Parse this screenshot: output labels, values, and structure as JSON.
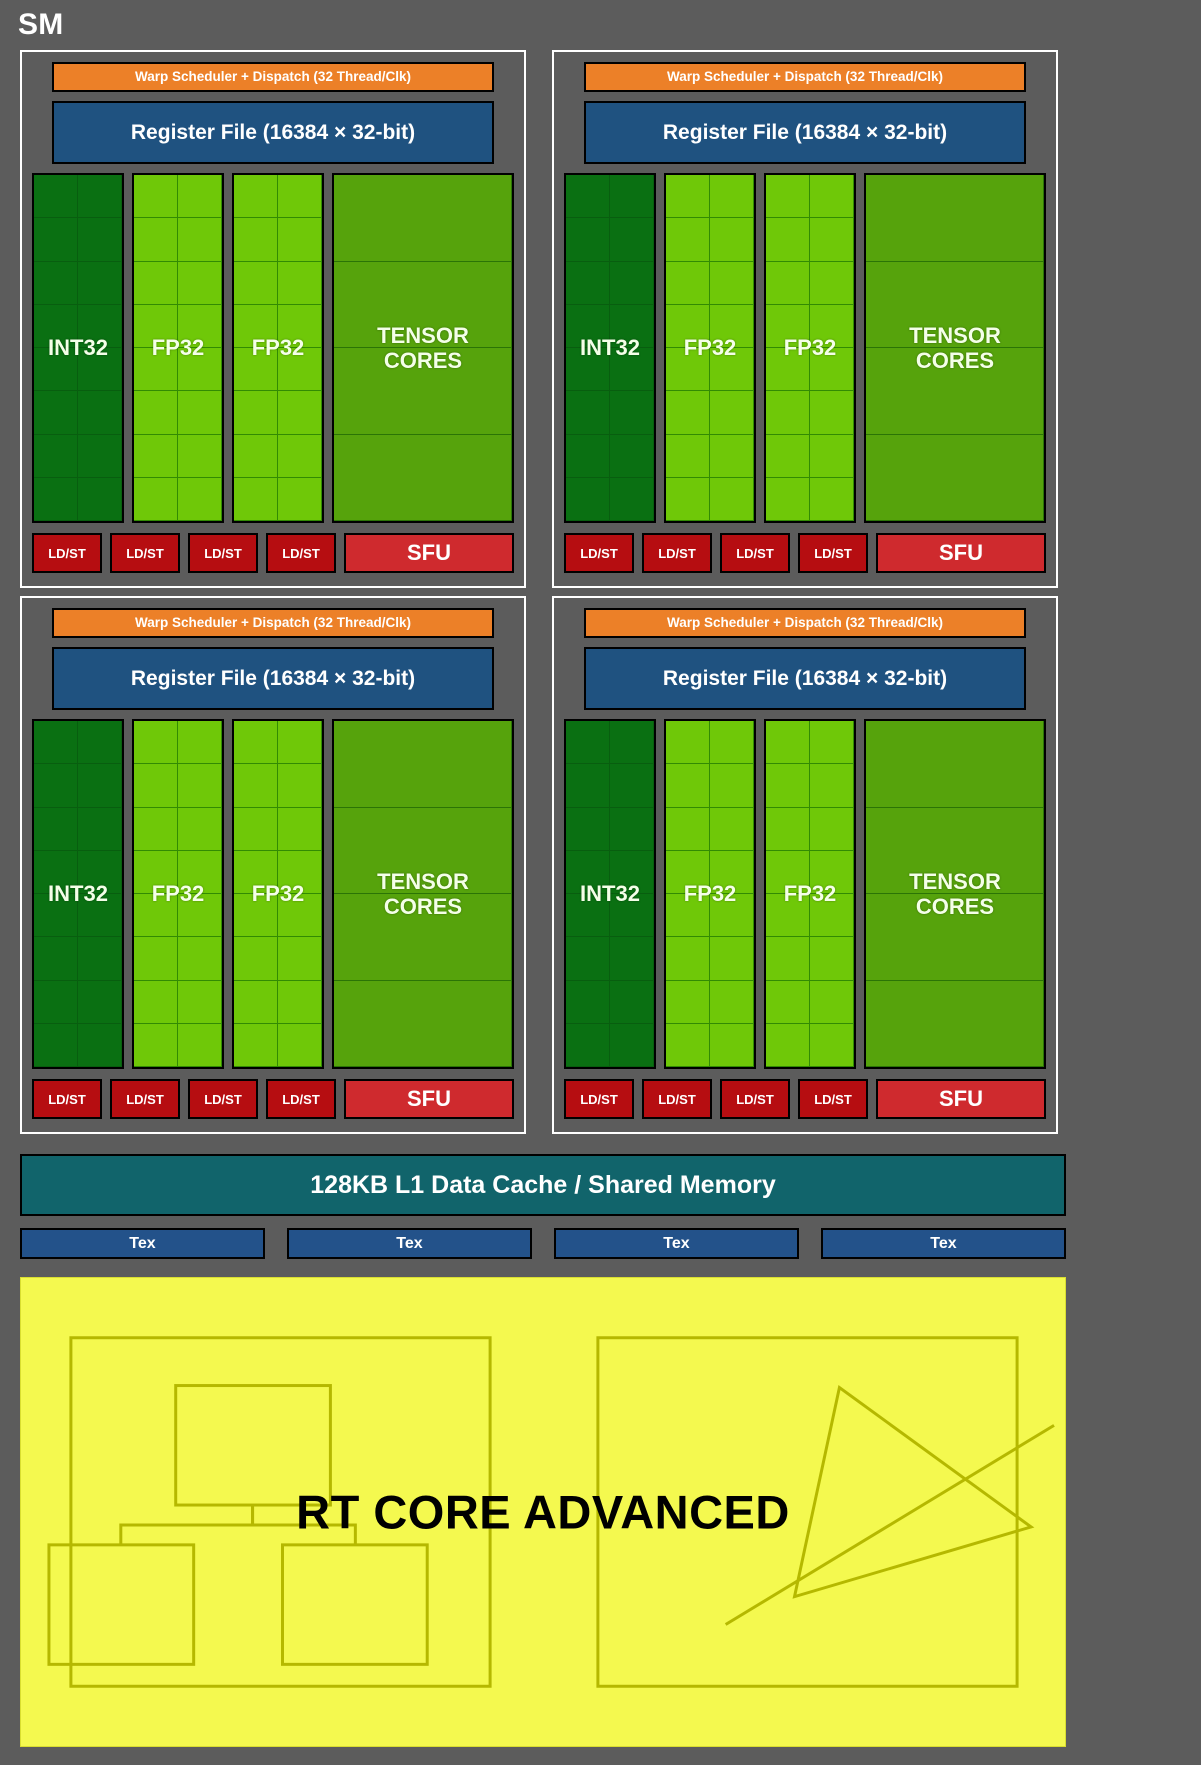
{
  "diagram": {
    "title": "SM",
    "background_color": "#5c5c5c"
  },
  "processing_blocks": [
    {
      "warp_scheduler": "Warp Scheduler + Dispatch (32 Thread/Clk)",
      "register_file": "Register File (16384 × 32-bit)",
      "cores": [
        {
          "label": "INT32",
          "type": "int32",
          "color": "#0a7012",
          "cols": 2,
          "rows": 8
        },
        {
          "label": "FP32",
          "type": "fp32",
          "color": "#6fc808",
          "cols": 2,
          "rows": 8
        },
        {
          "label": "FP32",
          "type": "fp32",
          "color": "#6fc808",
          "cols": 2,
          "rows": 8
        },
        {
          "label": "TENSOR\nCORES",
          "type": "tensor",
          "color": "#56a30c",
          "cols": 1,
          "rows": 4
        }
      ],
      "ldst": [
        "LD/ST",
        "LD/ST",
        "LD/ST",
        "LD/ST"
      ],
      "sfu": "SFU"
    },
    {
      "warp_scheduler": "Warp Scheduler + Dispatch (32 Thread/Clk)",
      "register_file": "Register File (16384 × 32-bit)",
      "cores": [
        {
          "label": "INT32",
          "type": "int32",
          "color": "#0a7012",
          "cols": 2,
          "rows": 8
        },
        {
          "label": "FP32",
          "type": "fp32",
          "color": "#6fc808",
          "cols": 2,
          "rows": 8
        },
        {
          "label": "FP32",
          "type": "fp32",
          "color": "#6fc808",
          "cols": 2,
          "rows": 8
        },
        {
          "label": "TENSOR\nCORES",
          "type": "tensor",
          "color": "#56a30c",
          "cols": 1,
          "rows": 4
        }
      ],
      "ldst": [
        "LD/ST",
        "LD/ST",
        "LD/ST",
        "LD/ST"
      ],
      "sfu": "SFU"
    },
    {
      "warp_scheduler": "Warp Scheduler + Dispatch (32 Thread/Clk)",
      "register_file": "Register File (16384 × 32-bit)",
      "cores": [
        {
          "label": "INT32",
          "type": "int32",
          "color": "#0a7012",
          "cols": 2,
          "rows": 8
        },
        {
          "label": "FP32",
          "type": "fp32",
          "color": "#6fc808",
          "cols": 2,
          "rows": 8
        },
        {
          "label": "FP32",
          "type": "fp32",
          "color": "#6fc808",
          "cols": 2,
          "rows": 8
        },
        {
          "label": "TENSOR\nCORES",
          "type": "tensor",
          "color": "#56a30c",
          "cols": 1,
          "rows": 4
        }
      ],
      "ldst": [
        "LD/ST",
        "LD/ST",
        "LD/ST",
        "LD/ST"
      ],
      "sfu": "SFU"
    },
    {
      "warp_scheduler": "Warp Scheduler + Dispatch (32 Thread/Clk)",
      "register_file": "Register File (16384 × 32-bit)",
      "cores": [
        {
          "label": "INT32",
          "type": "int32",
          "color": "#0a7012",
          "cols": 2,
          "rows": 8
        },
        {
          "label": "FP32",
          "type": "fp32",
          "color": "#6fc808",
          "cols": 2,
          "rows": 8
        },
        {
          "label": "FP32",
          "type": "fp32",
          "color": "#6fc808",
          "cols": 2,
          "rows": 8
        },
        {
          "label": "TENSOR\nCORES",
          "type": "tensor",
          "color": "#56a30c",
          "cols": 1,
          "rows": 4
        }
      ],
      "ldst": [
        "LD/ST",
        "LD/ST",
        "LD/ST",
        "LD/ST"
      ],
      "sfu": "SFU"
    }
  ],
  "l1_cache": {
    "label": "128KB L1 Data Cache / Shared Memory",
    "color": "#11646b"
  },
  "tex_units": {
    "labels": [
      "Tex",
      "Tex",
      "Tex",
      "Tex"
    ],
    "color": "#23528a"
  },
  "rt_core": {
    "label": "RT CORE ADVANCED",
    "background_color": "#f4f94f",
    "line_color": "#b5b800",
    "left_panel": "bvh-tree-diagram",
    "right_panel": "ray-triangle-intersection-diagram"
  },
  "colors": {
    "warp_scheduler": "#ec8028",
    "register_file": "#1f5280",
    "int32": "#0a7012",
    "fp32": "#6fc808",
    "tensor": "#56a30c",
    "ldst": "#b60d11",
    "sfu": "#cf2a2e",
    "block_border": "#ffffff"
  }
}
